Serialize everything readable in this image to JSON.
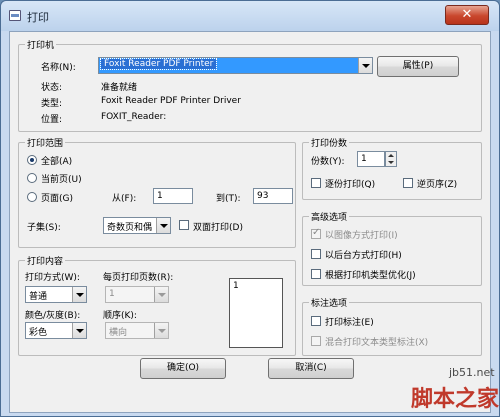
{
  "window": {
    "title": "打印",
    "close_glyph": "✕"
  },
  "printer": {
    "group_label": "打印机",
    "name_label": "名称(N):",
    "name_value": "Foxit Reader PDF Printer",
    "properties_button": "属性(P)",
    "status_label": "状态:",
    "status_value": "准备就绪",
    "type_label": "类型:",
    "type_value": "Foxit Reader PDF Printer Driver",
    "location_label": "位置:",
    "location_value": "FOXIT_Reader:"
  },
  "range": {
    "group_label": "打印范围",
    "all_label": "全部(A)",
    "current_label": "当前页(U)",
    "pages_label": "页面(G)",
    "from_label": "从(F):",
    "from_value": "1",
    "to_label": "到(T):",
    "to_value": "93",
    "subset_label": "子集(S):",
    "subset_value": "奇数页和偶",
    "duplex_label": "双面打印(D)",
    "selected": "all"
  },
  "copies": {
    "group_label": "打印份数",
    "count_label": "份数(Y):",
    "count_value": "1",
    "collate_label": "逐份打印(Q)",
    "reverse_label": "逆页序(Z)"
  },
  "advanced": {
    "group_label": "高级选项",
    "print_as_image_label": "以图像方式打印(I)",
    "print_as_image_checked": true,
    "background_label": "以后台方式打印(H)",
    "optimize_label": "根据打印机类型优化(J)"
  },
  "content": {
    "group_label": "打印内容",
    "mode_label": "打印方式(W):",
    "mode_value": "普通",
    "pages_per_sheet_label": "每页打印页数(R):",
    "pages_per_sheet_value": "1",
    "color_label": "颜色/灰度(B):",
    "color_value": "彩色",
    "order_label": "顺序(K):",
    "order_value": "横向",
    "preview_number": "1"
  },
  "annotations": {
    "group_label": "标注选项",
    "print_annotations_label": "打印标注(E)",
    "mixed_label": "混合打印文本类型标注(X)"
  },
  "buttons": {
    "ok": "确定(O)",
    "cancel": "取消(C)"
  },
  "watermark": {
    "site": "jb51.net",
    "brand": "脚本之家"
  }
}
